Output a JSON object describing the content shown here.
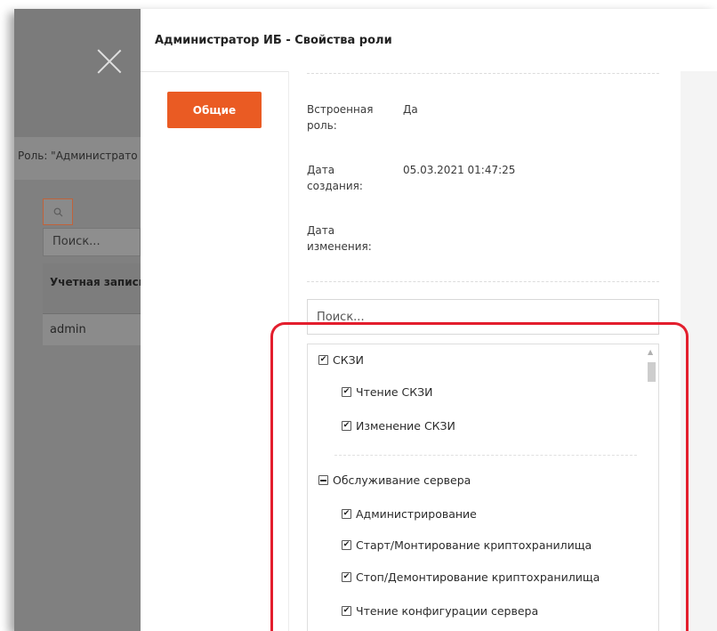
{
  "background": {
    "role_label": "Роль: \"Администрато",
    "search_icon": "search-icon",
    "search_placeholder": "Поиск...",
    "table_header": "Учетная запись",
    "table_row": "admin"
  },
  "modal": {
    "title": "Администратор ИБ - Свойства роли",
    "tab_label": "Общие",
    "properties": [
      {
        "label": "Встроенная роль:",
        "value": "Да"
      },
      {
        "label": "Дата создания:",
        "value": "05.03.2021 01:47:25"
      },
      {
        "label": "Дата изменения:",
        "value": ""
      }
    ],
    "tree_search_placeholder": "Поиск...",
    "tree": [
      {
        "label": "СКЗИ",
        "state": "checked"
      },
      {
        "label": "Чтение СКЗИ",
        "state": "checked"
      },
      {
        "label": "Изменение СКЗИ",
        "state": "checked"
      },
      {
        "label": "Обслуживание сервера",
        "state": "partial"
      },
      {
        "label": "Администрирование",
        "state": "checked"
      },
      {
        "label": "Старт/Монтирование криптохранилища",
        "state": "checked"
      },
      {
        "label": "Стоп/Демонтирование криптохранилища",
        "state": "checked"
      },
      {
        "label": "Чтение конфигурации сервера",
        "state": "checked"
      }
    ]
  },
  "colors": {
    "accent": "#ea5b23",
    "highlight": "#e31e2d",
    "overlay": "#7f7f7f"
  }
}
